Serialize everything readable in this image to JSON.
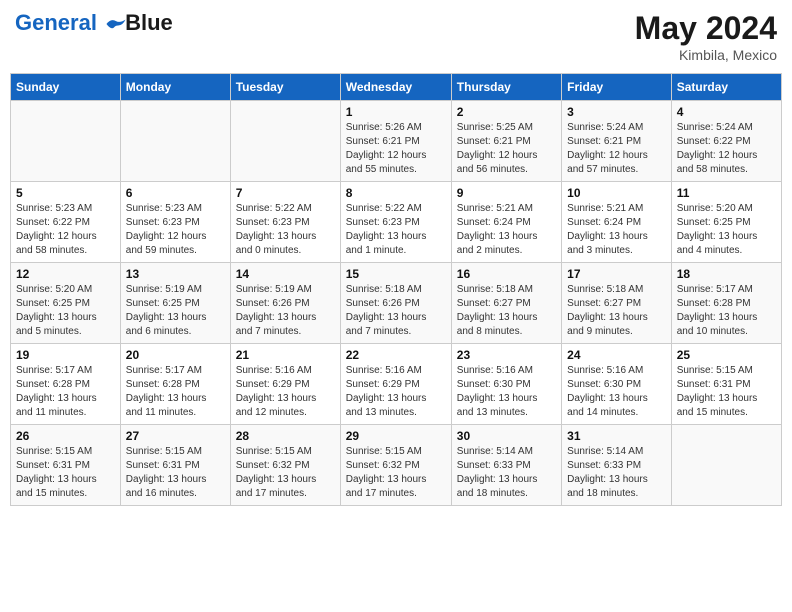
{
  "header": {
    "logo_line1": "General",
    "logo_line2": "Blue",
    "month_year": "May 2024",
    "location": "Kimbila, Mexico"
  },
  "weekdays": [
    "Sunday",
    "Monday",
    "Tuesday",
    "Wednesday",
    "Thursday",
    "Friday",
    "Saturday"
  ],
  "weeks": [
    [
      {
        "day": "",
        "info": ""
      },
      {
        "day": "",
        "info": ""
      },
      {
        "day": "",
        "info": ""
      },
      {
        "day": "1",
        "info": "Sunrise: 5:26 AM\nSunset: 6:21 PM\nDaylight: 12 hours\nand 55 minutes."
      },
      {
        "day": "2",
        "info": "Sunrise: 5:25 AM\nSunset: 6:21 PM\nDaylight: 12 hours\nand 56 minutes."
      },
      {
        "day": "3",
        "info": "Sunrise: 5:24 AM\nSunset: 6:21 PM\nDaylight: 12 hours\nand 57 minutes."
      },
      {
        "day": "4",
        "info": "Sunrise: 5:24 AM\nSunset: 6:22 PM\nDaylight: 12 hours\nand 58 minutes."
      }
    ],
    [
      {
        "day": "5",
        "info": "Sunrise: 5:23 AM\nSunset: 6:22 PM\nDaylight: 12 hours\nand 58 minutes."
      },
      {
        "day": "6",
        "info": "Sunrise: 5:23 AM\nSunset: 6:23 PM\nDaylight: 12 hours\nand 59 minutes."
      },
      {
        "day": "7",
        "info": "Sunrise: 5:22 AM\nSunset: 6:23 PM\nDaylight: 13 hours\nand 0 minutes."
      },
      {
        "day": "8",
        "info": "Sunrise: 5:22 AM\nSunset: 6:23 PM\nDaylight: 13 hours\nand 1 minute."
      },
      {
        "day": "9",
        "info": "Sunrise: 5:21 AM\nSunset: 6:24 PM\nDaylight: 13 hours\nand 2 minutes."
      },
      {
        "day": "10",
        "info": "Sunrise: 5:21 AM\nSunset: 6:24 PM\nDaylight: 13 hours\nand 3 minutes."
      },
      {
        "day": "11",
        "info": "Sunrise: 5:20 AM\nSunset: 6:25 PM\nDaylight: 13 hours\nand 4 minutes."
      }
    ],
    [
      {
        "day": "12",
        "info": "Sunrise: 5:20 AM\nSunset: 6:25 PM\nDaylight: 13 hours\nand 5 minutes."
      },
      {
        "day": "13",
        "info": "Sunrise: 5:19 AM\nSunset: 6:25 PM\nDaylight: 13 hours\nand 6 minutes."
      },
      {
        "day": "14",
        "info": "Sunrise: 5:19 AM\nSunset: 6:26 PM\nDaylight: 13 hours\nand 7 minutes."
      },
      {
        "day": "15",
        "info": "Sunrise: 5:18 AM\nSunset: 6:26 PM\nDaylight: 13 hours\nand 7 minutes."
      },
      {
        "day": "16",
        "info": "Sunrise: 5:18 AM\nSunset: 6:27 PM\nDaylight: 13 hours\nand 8 minutes."
      },
      {
        "day": "17",
        "info": "Sunrise: 5:18 AM\nSunset: 6:27 PM\nDaylight: 13 hours\nand 9 minutes."
      },
      {
        "day": "18",
        "info": "Sunrise: 5:17 AM\nSunset: 6:28 PM\nDaylight: 13 hours\nand 10 minutes."
      }
    ],
    [
      {
        "day": "19",
        "info": "Sunrise: 5:17 AM\nSunset: 6:28 PM\nDaylight: 13 hours\nand 11 minutes."
      },
      {
        "day": "20",
        "info": "Sunrise: 5:17 AM\nSunset: 6:28 PM\nDaylight: 13 hours\nand 11 minutes."
      },
      {
        "day": "21",
        "info": "Sunrise: 5:16 AM\nSunset: 6:29 PM\nDaylight: 13 hours\nand 12 minutes."
      },
      {
        "day": "22",
        "info": "Sunrise: 5:16 AM\nSunset: 6:29 PM\nDaylight: 13 hours\nand 13 minutes."
      },
      {
        "day": "23",
        "info": "Sunrise: 5:16 AM\nSunset: 6:30 PM\nDaylight: 13 hours\nand 13 minutes."
      },
      {
        "day": "24",
        "info": "Sunrise: 5:16 AM\nSunset: 6:30 PM\nDaylight: 13 hours\nand 14 minutes."
      },
      {
        "day": "25",
        "info": "Sunrise: 5:15 AM\nSunset: 6:31 PM\nDaylight: 13 hours\nand 15 minutes."
      }
    ],
    [
      {
        "day": "26",
        "info": "Sunrise: 5:15 AM\nSunset: 6:31 PM\nDaylight: 13 hours\nand 15 minutes."
      },
      {
        "day": "27",
        "info": "Sunrise: 5:15 AM\nSunset: 6:31 PM\nDaylight: 13 hours\nand 16 minutes."
      },
      {
        "day": "28",
        "info": "Sunrise: 5:15 AM\nSunset: 6:32 PM\nDaylight: 13 hours\nand 17 minutes."
      },
      {
        "day": "29",
        "info": "Sunrise: 5:15 AM\nSunset: 6:32 PM\nDaylight: 13 hours\nand 17 minutes."
      },
      {
        "day": "30",
        "info": "Sunrise: 5:14 AM\nSunset: 6:33 PM\nDaylight: 13 hours\nand 18 minutes."
      },
      {
        "day": "31",
        "info": "Sunrise: 5:14 AM\nSunset: 6:33 PM\nDaylight: 13 hours\nand 18 minutes."
      },
      {
        "day": "",
        "info": ""
      }
    ]
  ]
}
